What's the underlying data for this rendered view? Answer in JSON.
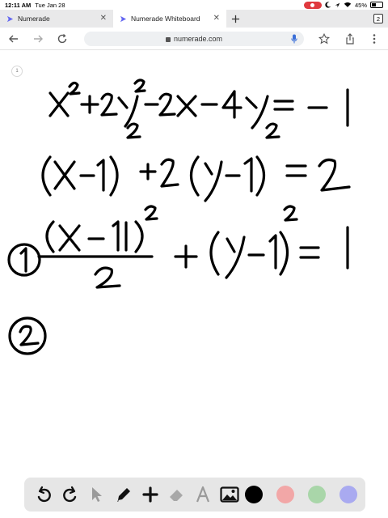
{
  "status": {
    "time": "12:11 AM",
    "date": "Tue Jan 28",
    "battery": "45%",
    "battery_level": 0.45
  },
  "tabs": [
    {
      "title": "Numerade",
      "active": false
    },
    {
      "title": "Numerade Whiteboard",
      "active": true
    }
  ],
  "tab_count": "2",
  "omnibox": {
    "url": "numerade.com"
  },
  "board": {
    "page_number": "1",
    "ink": {
      "line1": "x²+2y²-2x-4y=-1",
      "line2": "(x-1)²+2(y-1)²=2",
      "line3": "(x-1)²/2+(y-1)²=1",
      "step1": "1",
      "step2": "2"
    }
  },
  "toolbar": {
    "tools": [
      "undo-icon",
      "redo-icon",
      "pointer-icon",
      "pen-icon",
      "add-icon",
      "eraser-icon",
      "text-icon",
      "image-icon"
    ],
    "colors": [
      "#000000",
      "#f2a7a7",
      "#a9d6a9",
      "#a9aaf0"
    ]
  },
  "colors": {
    "ink": "#000000",
    "record": "#e0393e",
    "brand": "#6366f1"
  }
}
